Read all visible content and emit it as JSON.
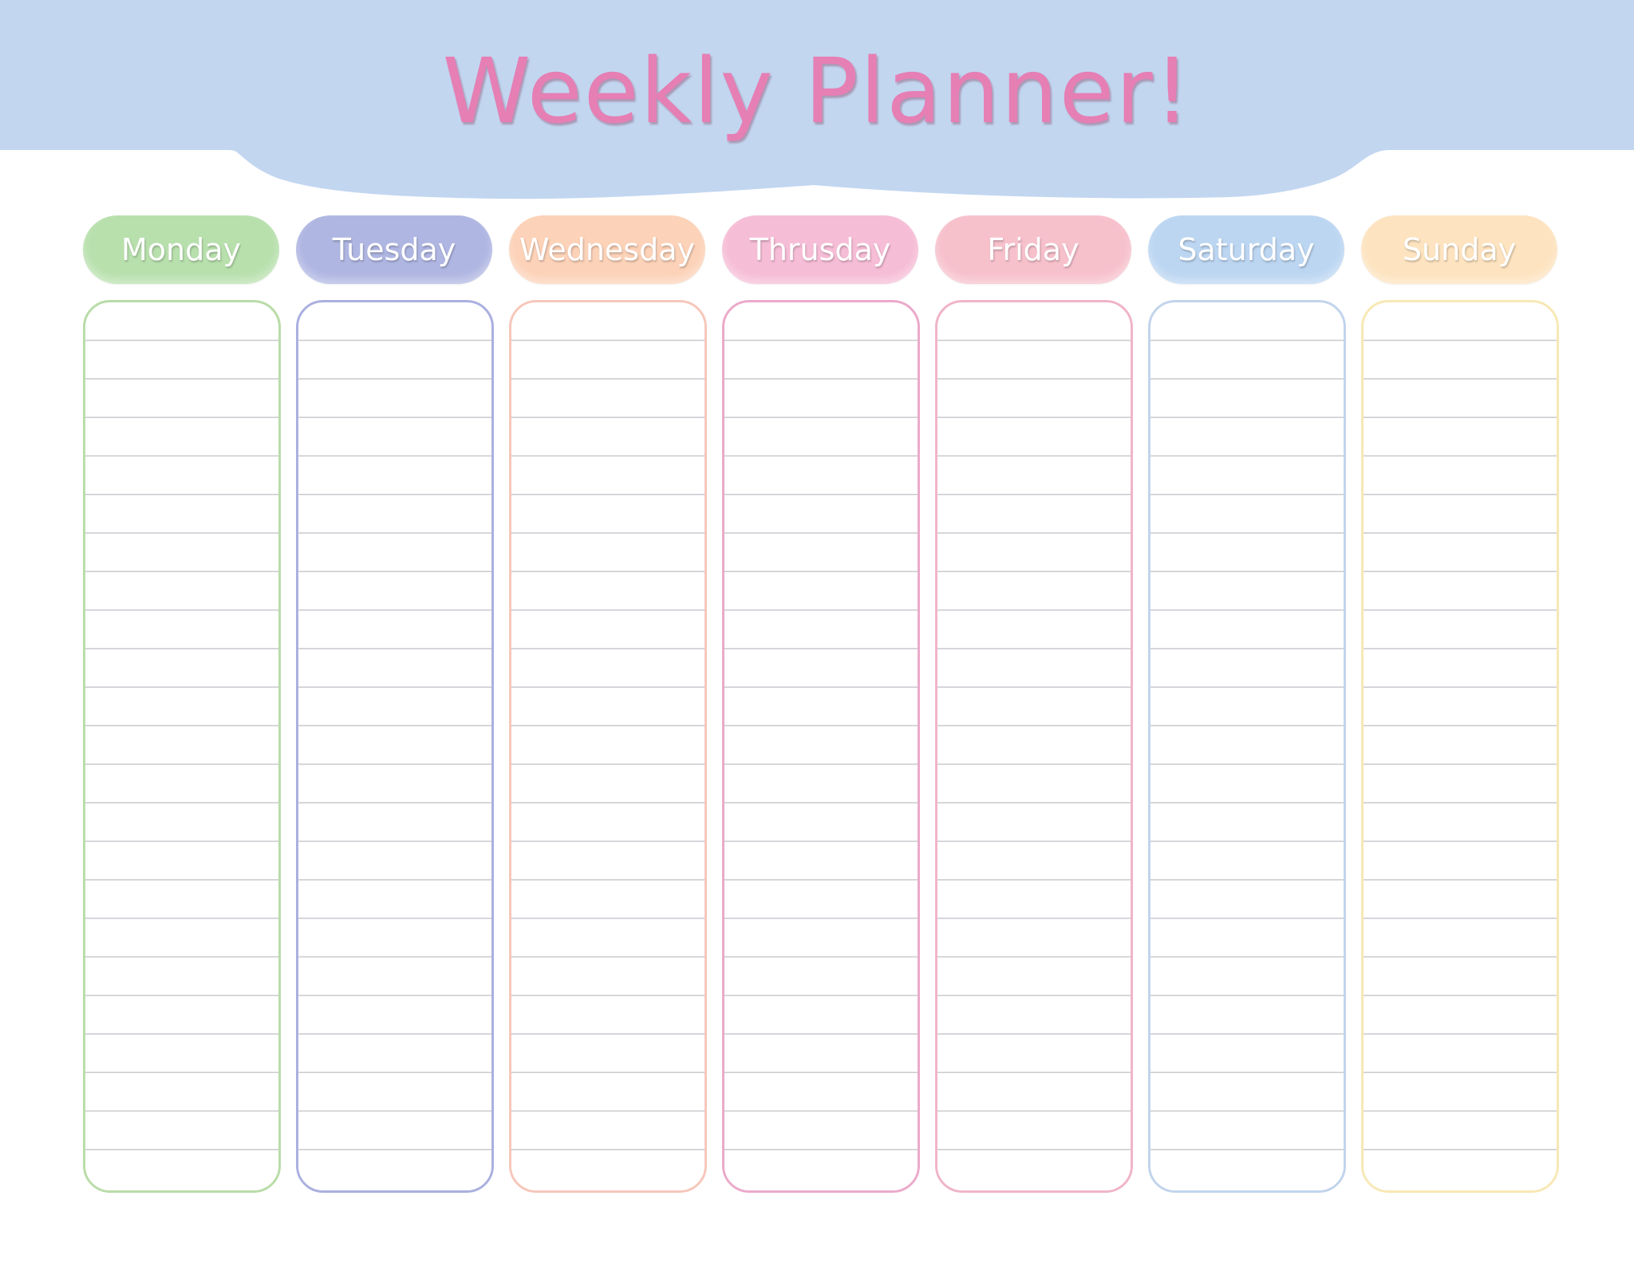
{
  "title": "Weekly Planner!",
  "colors": {
    "header_band": "#c2d6f0",
    "title": "#e57fb4"
  },
  "days": [
    {
      "label": "Monday",
      "pill_color": "#b8e0ad",
      "border_color": "#b9dca8"
    },
    {
      "label": "Tuesday",
      "pill_color": "#afb6e2",
      "border_color": "#aab0df"
    },
    {
      "label": "Wednesday",
      "pill_color": "#fcd2b8",
      "border_color": "#f6c7ba"
    },
    {
      "label": "Thrusday",
      "pill_color": "#f6bdd6",
      "border_color": "#ebaaca"
    },
    {
      "label": "Friday",
      "pill_color": "#f7c1cc",
      "border_color": "#f0b4c9"
    },
    {
      "label": "Saturday",
      "pill_color": "#bcd6f2",
      "border_color": "#c2d4ec"
    },
    {
      "label": "Sunday",
      "pill_color": "#fde3bf",
      "border_color": "#f7e8b5"
    }
  ]
}
